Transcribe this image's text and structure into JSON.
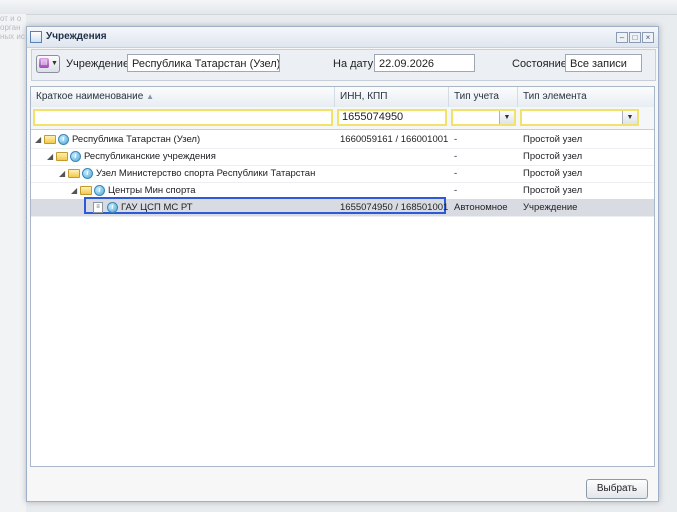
{
  "background": {
    "side_text": [
      "от и о",
      "орган",
      "ных ис"
    ]
  },
  "window": {
    "title": "Учреждения",
    "controls": {
      "minimize": "–",
      "restore": "□",
      "close": "×"
    }
  },
  "toolbar": {
    "selector_icon": "pink-document-icon",
    "institution_label": "Учреждение:",
    "institution_value": "Республика Татарстан (Узел)",
    "date_label": "На дату:",
    "date_value": "22.09.2026",
    "state_label": "Состояние:",
    "state_value": "Все записи"
  },
  "grid": {
    "columns": [
      "Краткое наименование",
      "ИНН, КПП",
      "Тип учета",
      "Тип элемента"
    ],
    "sort_indicator": "▲",
    "filters": {
      "name": "",
      "inn": "1655074950",
      "account_type": "",
      "element_type": ""
    },
    "rows": [
      {
        "name": "Республика Татарстан (Узел)",
        "inn": "1660059161 / 166001001",
        "account": "-",
        "element": "Простой узел",
        "level": 0,
        "kind": "folder"
      },
      {
        "name": "Республиканские учреждения",
        "inn": "",
        "account": "-",
        "element": "Простой узел",
        "level": 1,
        "kind": "folder"
      },
      {
        "name": "Узел Министерство спорта Республики Татарстан",
        "inn": "",
        "account": "-",
        "element": "Простой узел",
        "level": 2,
        "kind": "folder"
      },
      {
        "name": "Центры Мин спорта",
        "inn": "",
        "account": "-",
        "element": "Простой узел",
        "level": 3,
        "kind": "folder"
      },
      {
        "name": "ГАУ ЦСП МС РТ",
        "inn": "1655074950 / 168501001",
        "account": "Автономное",
        "element": "Учреждение",
        "level": 4,
        "kind": "doc",
        "selected": true
      }
    ]
  },
  "footer": {
    "select_button": "Выбрать"
  }
}
